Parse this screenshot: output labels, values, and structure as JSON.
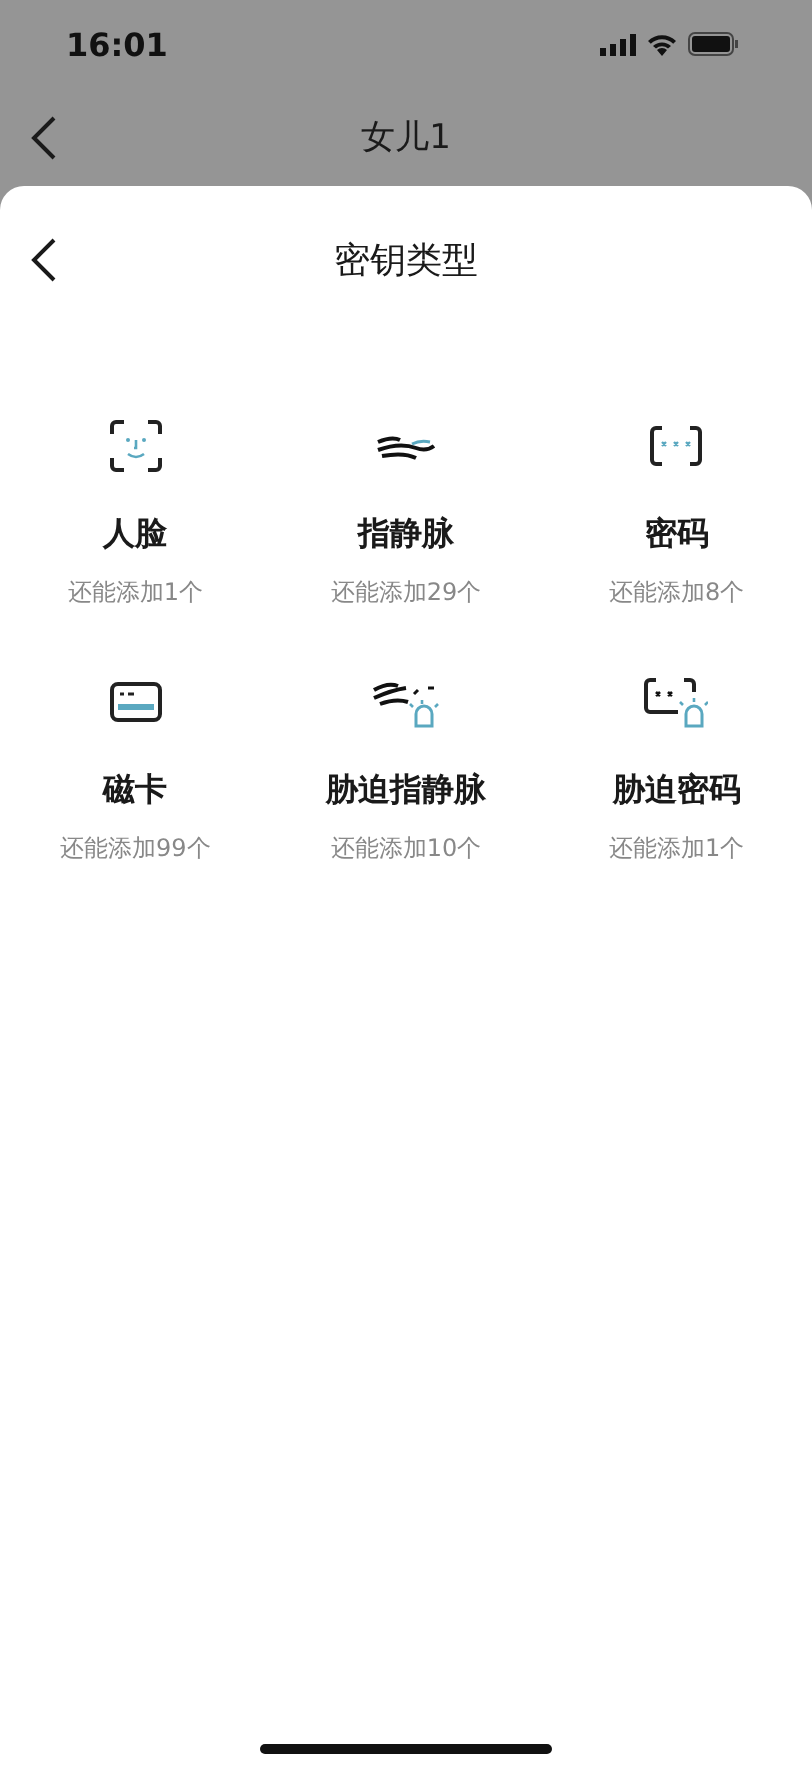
{
  "status_bar": {
    "time": "16:01"
  },
  "background_nav": {
    "title": "女儿1"
  },
  "sheet": {
    "title": "密钥类型"
  },
  "key_types": [
    {
      "kind": "face",
      "name": "人脸",
      "remaining": "还能添加1个"
    },
    {
      "kind": "vein",
      "name": "指静脉",
      "remaining": "还能添加29个"
    },
    {
      "kind": "password",
      "name": "密码",
      "remaining": "还能添加8个"
    },
    {
      "kind": "card",
      "name": "磁卡",
      "remaining": "还能添加99个"
    },
    {
      "kind": "duress-vein",
      "name": "胁迫指静脉",
      "remaining": "还能添加10个"
    },
    {
      "kind": "duress-password",
      "name": "胁迫密码",
      "remaining": "还能添加1个"
    }
  ]
}
